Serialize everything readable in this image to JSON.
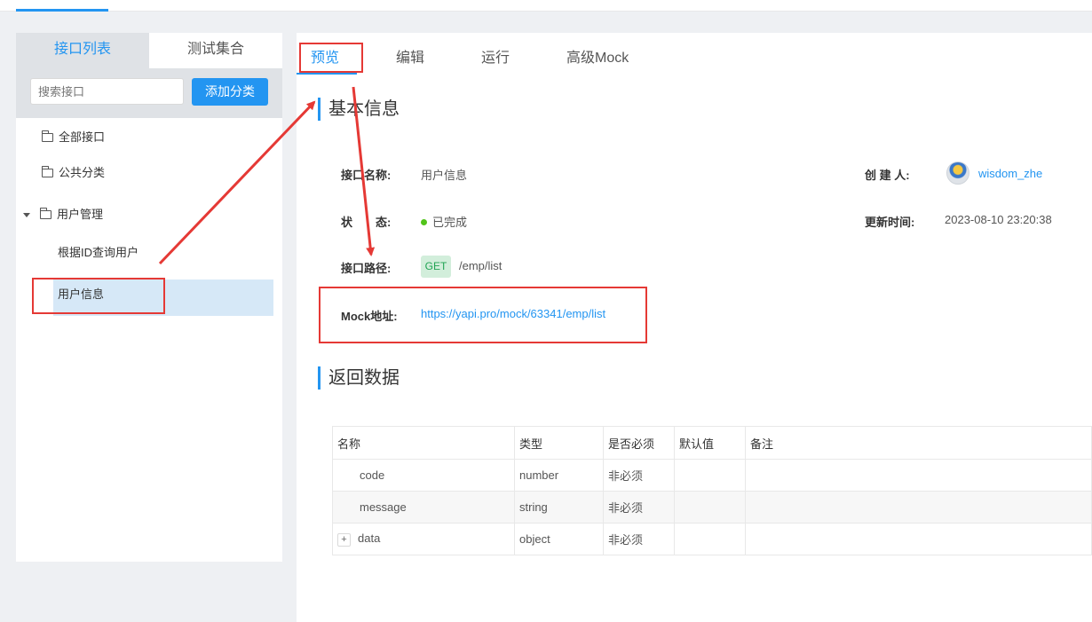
{
  "sidebar": {
    "tabs": [
      {
        "label": "接口列表"
      },
      {
        "label": "测试集合"
      }
    ],
    "search": {
      "placeholder": "搜索接口"
    },
    "add_button": "添加分类",
    "tree": [
      {
        "label": "全部接口"
      },
      {
        "label": "公共分类"
      },
      {
        "label": "用户管理"
      },
      {
        "label": "根据ID查询用户"
      },
      {
        "label": "用户信息"
      }
    ]
  },
  "main": {
    "tabs": [
      {
        "label": "预览"
      },
      {
        "label": "编辑"
      },
      {
        "label": "运行"
      },
      {
        "label": "高级Mock"
      }
    ],
    "basic_info": {
      "title": "基本信息",
      "name_label": "接口名称:",
      "name_value": "用户信息",
      "creator_label": "创 建 人:",
      "creator_value": "wisdom_zhe",
      "status_label": "状　　态:",
      "status_value": "已完成",
      "updated_label": "更新时间:",
      "updated_value": "2023-08-10 23:20:38",
      "path_label": "接口路径:",
      "method": "GET",
      "path_value": "/emp/list",
      "mock_label": "Mock地址:",
      "mock_value": "https://yapi.pro/mock/63341/emp/list"
    },
    "return_data": {
      "title": "返回数据",
      "headers": [
        "名称",
        "类型",
        "是否必须",
        "默认值",
        "备注"
      ],
      "rows": [
        {
          "name": "code",
          "type": "number",
          "required": "非必须",
          "default": "",
          "note": ""
        },
        {
          "name": "message",
          "type": "string",
          "required": "非必须",
          "default": "",
          "note": ""
        },
        {
          "name": "data",
          "type": "object",
          "required": "非必须",
          "default": "",
          "note": "",
          "expand": "+"
        }
      ]
    }
  },
  "colors": {
    "accent": "#2395f1",
    "status_done": "#52c41a",
    "annotation_red": "#e53935",
    "get_tag_bg": "#d2eedb"
  }
}
